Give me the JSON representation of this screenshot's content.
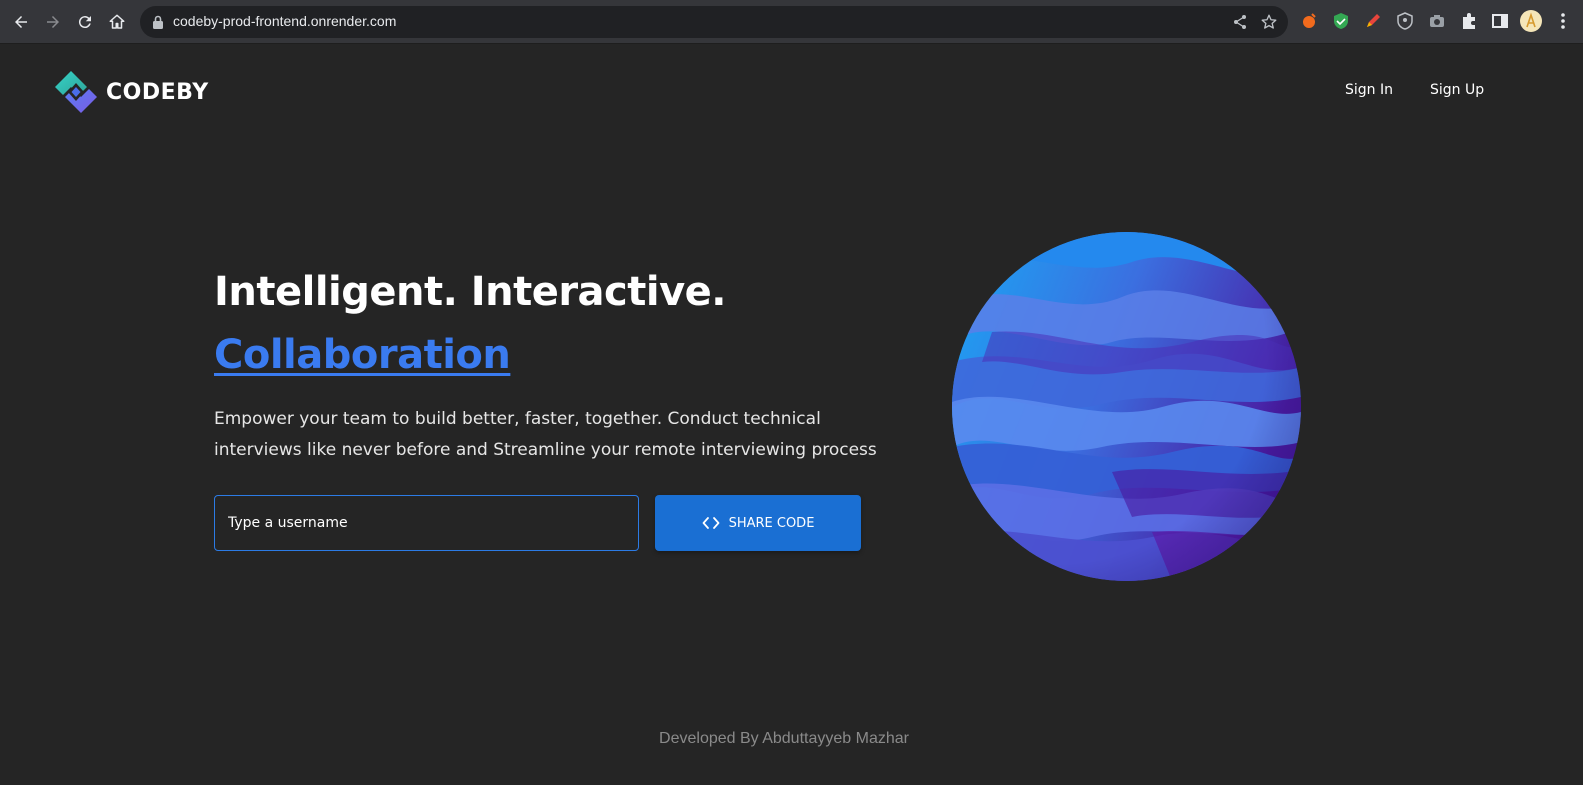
{
  "browser": {
    "url": "codeby-prod-frontend.onrender.com",
    "icons": [
      "back-icon",
      "forward-icon",
      "reload-icon",
      "home-icon",
      "lock-icon",
      "share-icon",
      "star-icon",
      "extension-icons",
      "puzzle-icon",
      "sidebar-icon",
      "profile-avatar",
      "menu-icon"
    ]
  },
  "brand": {
    "name": "CODEBY"
  },
  "nav": {
    "sign_in": "Sign In",
    "sign_up": "Sign Up"
  },
  "hero": {
    "headline": "Intelligent. Interactive.",
    "highlight": "Collaboration",
    "description": "Empower your team to build better, faster, together. Conduct technical interviews like never before and Streamline your remote interviewing process"
  },
  "form": {
    "username_placeholder": "Type a username",
    "share_label": "SHARE CODE"
  },
  "footer": {
    "credit": "Developed By Abduttayyeb Mazhar"
  },
  "colors": {
    "background": "#252525",
    "accent": "#3a7bf0",
    "button": "#1a6fd3",
    "chrome": "#35363a"
  }
}
